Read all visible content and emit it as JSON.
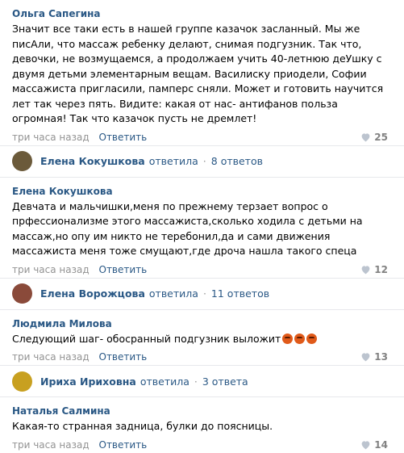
{
  "comments": [
    {
      "author": "Ольга Сапегина",
      "text": "Значит все таки есть в нашей группе казачок засланный. Мы же писАли, что массаж ребенку делают, снимая подгузник. Так что, девочки, не возмущаемся, а продолжаем учить 40-летнюю деУшку с двумя детьми элементарным вещам. Василиску приодели, Софии массажиста пригласили, памперс сняли. Может и готовить научится лет так через пять. Видите: какая от нас- антифанов польза огромная! Так что казачок пусть не дремлет!",
      "time": "три часа назад",
      "reply": "Ответить",
      "likes": "25"
    },
    {
      "author": "Елена Кокушкова",
      "text": "Девчата и мальчишки,меня по прежнему терзает вопрос о прфессионализме этого массажиста,сколько ходила с детьми на массаж,но опу им никто не теребонил,да и сами движения массажиста меня тоже смущают,где дроча нашла такого спеца",
      "time": "три часа назад",
      "reply": "Ответить",
      "likes": "12"
    },
    {
      "author": "Людмила Милова",
      "text": "Следующий шаг- обосранный подгузник выложит",
      "time": "три часа назад",
      "reply": "Ответить",
      "likes": "13"
    },
    {
      "author": "Наталья Салмина",
      "text": "Какая-то странная задница, булки до поясницы.",
      "time": "три часа назад",
      "reply": "Ответить",
      "likes": "14"
    }
  ],
  "threads": [
    {
      "name": "Елена Кокушкова",
      "verb": "ответила",
      "count": "8 ответов",
      "avatar_color": "#6b5a3a"
    },
    {
      "name": "Елена Ворожцова",
      "verb": "ответила",
      "count": "11 ответов",
      "avatar_color": "#8a4a3a"
    },
    {
      "name": "Ириха Ириховна",
      "verb": "ответила",
      "count": "3 ответа",
      "avatar_color": "#c8a020"
    }
  ],
  "colors": {
    "link": "#2a5885",
    "meta": "#939393",
    "divider": "#e7e8ec"
  },
  "icons": [
    "heart-icon",
    "angry-emoji-icon"
  ]
}
